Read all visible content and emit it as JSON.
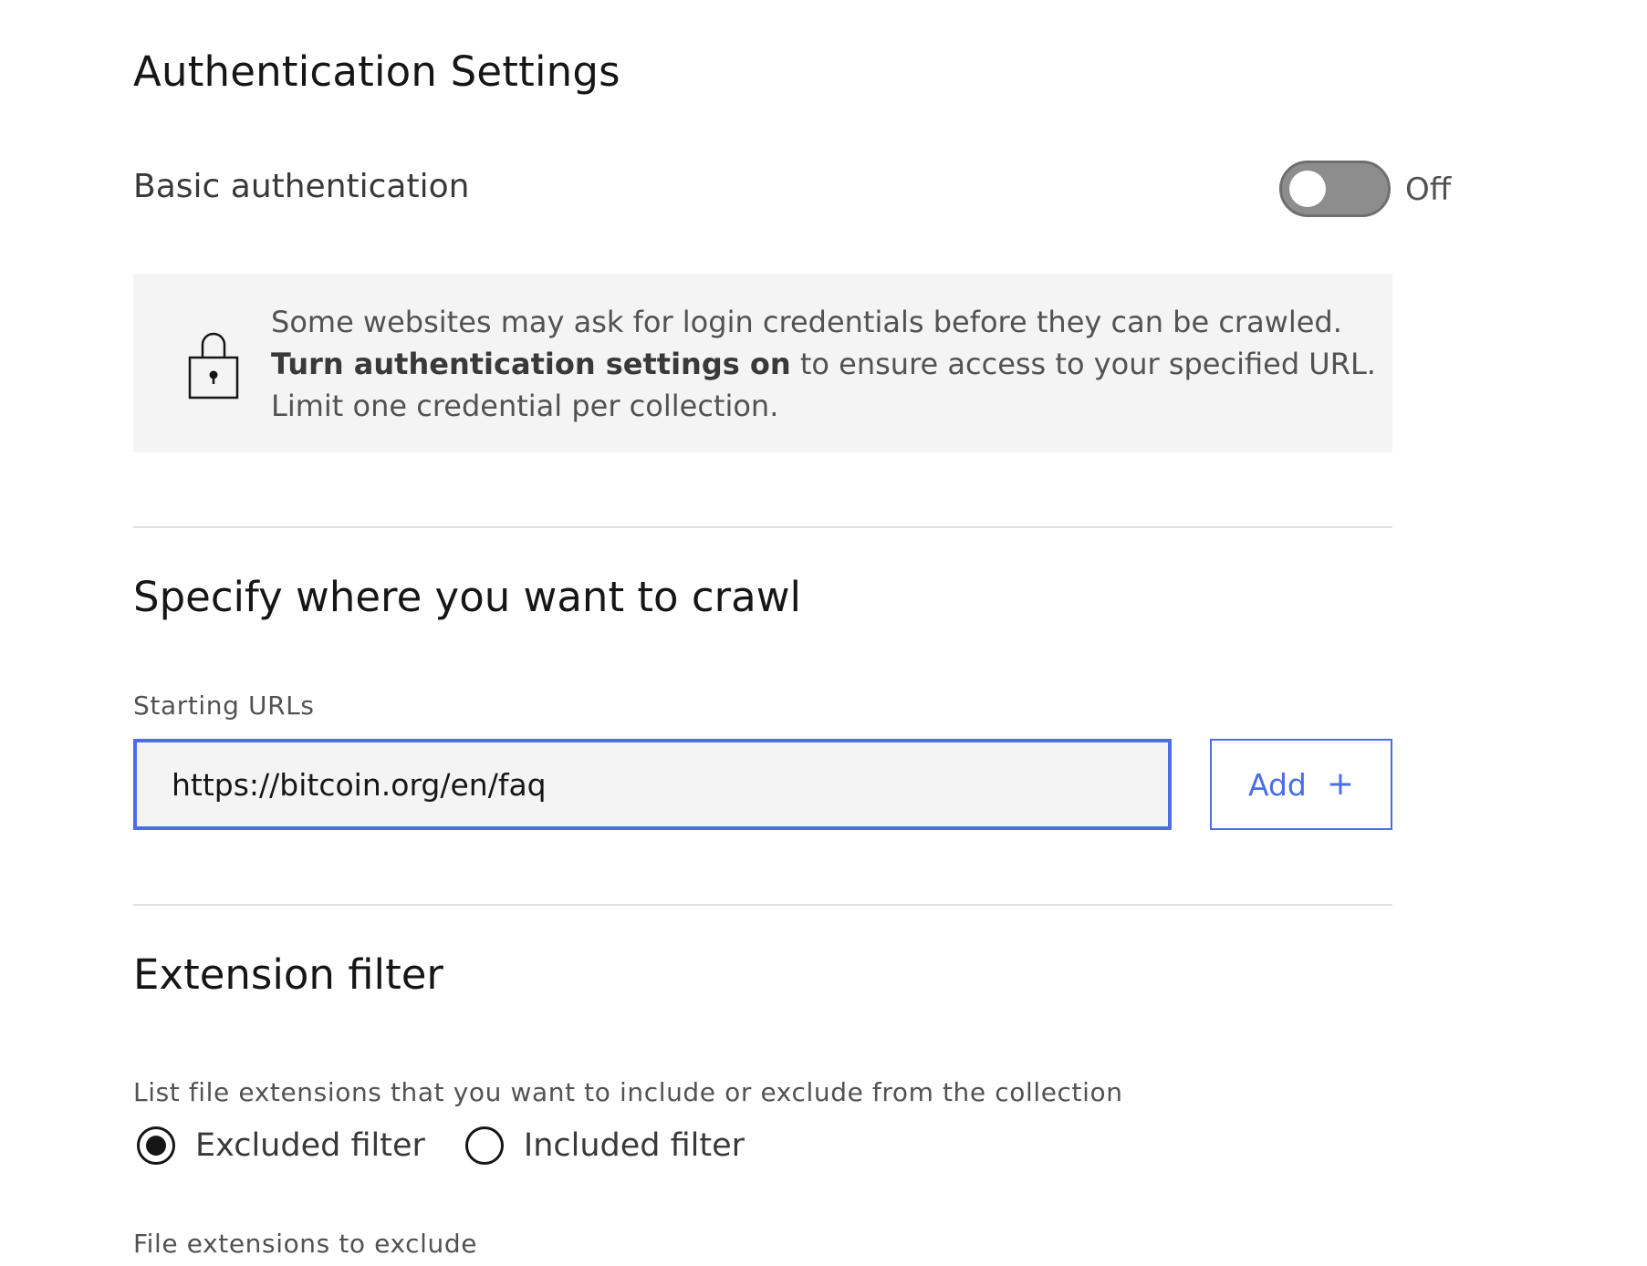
{
  "auth_section": {
    "title": "Authentication Settings",
    "toggle_label": "Basic authentication",
    "toggle_state": "Off",
    "notice": {
      "icon": "lock-icon",
      "line1": "Some websites may ask for login credentials before they can be crawled.",
      "line2_bold": "Turn authentication settings on",
      "line2_rest": " to ensure access to your specified URL.",
      "line3": "Limit one credential per collection."
    }
  },
  "crawl_section": {
    "title": "Specify where you want to crawl",
    "starting_urls_label": "Starting URLs",
    "url_value": "https://bitcoin.org/en/faq",
    "add_button_label": "Add",
    "add_button_icon": "+"
  },
  "extension_section": {
    "title": "Extension filter",
    "description": "List file extensions that you want to include or exclude from the collection",
    "options": [
      {
        "label": "Excluded filter",
        "checked": true
      },
      {
        "label": "Included filter",
        "checked": false
      }
    ],
    "extensions_label": "File extensions to exclude"
  },
  "colors": {
    "accent": "#4b6ee8",
    "toggle_off": "#8d8d8d",
    "notice_bg": "#f4f4f4",
    "divider": "#e0e0e0"
  }
}
